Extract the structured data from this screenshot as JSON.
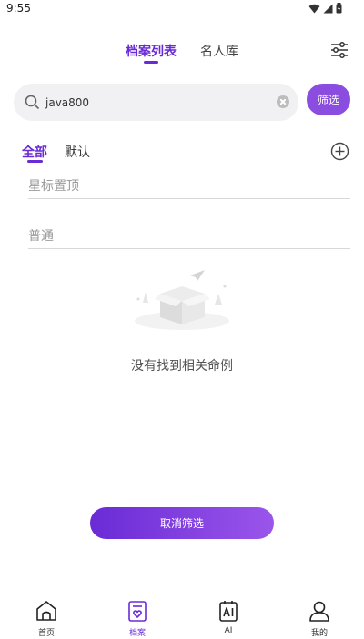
{
  "status_bar": {
    "time": "9:55"
  },
  "header": {
    "tabs": [
      {
        "label": "档案列表",
        "active": true
      },
      {
        "label": "名人库",
        "active": false
      }
    ],
    "settings_icon": "sliders-icon"
  },
  "search": {
    "value": "java800",
    "placeholder": ""
  },
  "filter_button": {
    "label": "筛选"
  },
  "sub_tabs": [
    {
      "label": "全部",
      "active": true
    },
    {
      "label": "默认",
      "active": false
    }
  ],
  "sections": {
    "starred": "星标置顶",
    "normal": "普通"
  },
  "empty_state": {
    "message": "没有找到相关命例"
  },
  "cancel_filter": {
    "label": "取消筛选"
  },
  "bottom_nav": [
    {
      "label": "首页",
      "icon": "home-icon"
    },
    {
      "label": "档案",
      "icon": "archive-icon",
      "active": true
    },
    {
      "label": "AI",
      "icon": "ai-icon"
    },
    {
      "label": "我的",
      "icon": "user-icon"
    }
  ],
  "colors": {
    "accent": "#6a2bd6",
    "accent_light": "#8b4de0"
  }
}
